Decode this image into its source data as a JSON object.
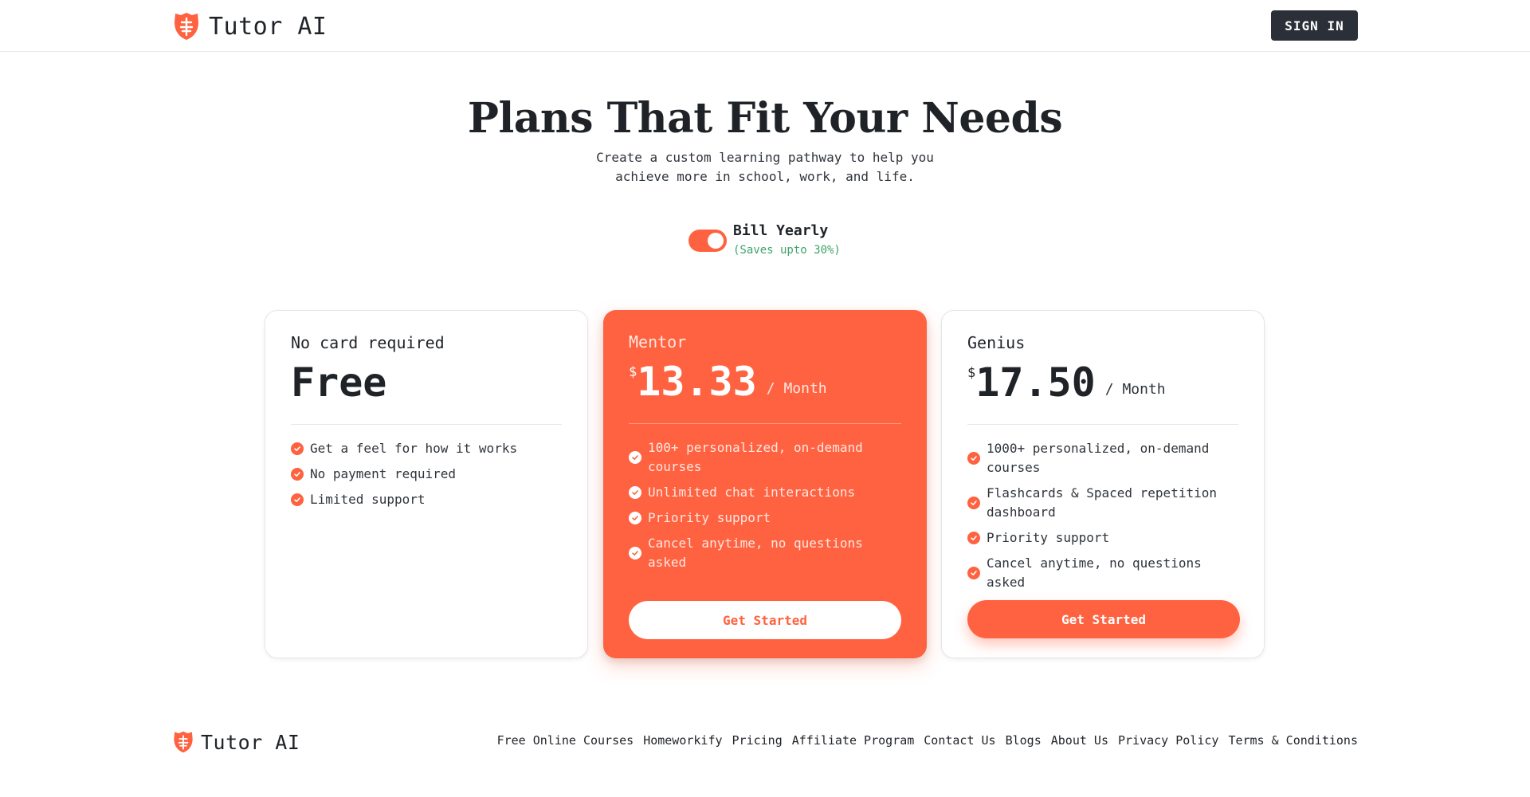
{
  "header": {
    "brand": "Tutor AI",
    "signin_label": "SIGN IN"
  },
  "hero": {
    "title": "Plans That Fit Your Needs",
    "subtitle_line1": "Create a custom learning pathway to help you",
    "subtitle_line2": "achieve more in school, work, and life."
  },
  "billing": {
    "label": "Bill Yearly",
    "savings": "(Saves upto 30%)",
    "yearly_enabled": true
  },
  "plans": [
    {
      "tag": "No card required",
      "currency": "",
      "amount": "Free",
      "period": "",
      "features": [
        "Get a feel for how it works",
        "No payment required",
        "Limited support"
      ],
      "cta": ""
    },
    {
      "tag": "Mentor",
      "currency": "$",
      "amount": "13.33",
      "period": "/ Month",
      "features": [
        "100+ personalized, on-demand courses",
        "Unlimited chat interactions",
        "Priority support",
        "Cancel anytime, no questions asked"
      ],
      "cta": "Get Started"
    },
    {
      "tag": "Genius",
      "currency": "$",
      "amount": "17.50",
      "period": "/ Month",
      "features": [
        "1000+ personalized, on-demand courses",
        "Flashcards & Spaced repetition dashboard",
        "Priority support",
        "Cancel anytime, no questions asked"
      ],
      "cta": "Get Started"
    }
  ],
  "footer": {
    "brand": "Tutor AI",
    "links": [
      "Free Online Courses",
      "Homeworkify",
      "Pricing",
      "Affiliate Program",
      "Contact Us",
      "Blogs",
      "About Us",
      "Privacy Policy",
      "Terms & Conditions"
    ]
  },
  "colors": {
    "accent": "#ff6240",
    "dark_button": "#2b3038",
    "savings_green": "#3ea36a"
  },
  "icons": {
    "logo": "shield-logo-icon",
    "feature_check": "check-circle-icon"
  }
}
